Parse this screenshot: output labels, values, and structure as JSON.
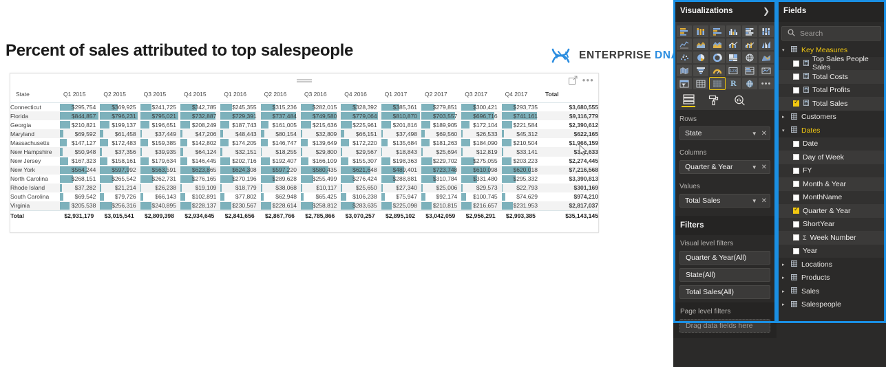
{
  "report": {
    "title": "Percent of sales attributed to top salespeople",
    "logo": {
      "primary": "ENTERPRISE",
      "secondary": "DNA",
      "icon": "dna-helix-icon"
    }
  },
  "matrix": {
    "actions": {
      "focus": "focus-mode-icon",
      "more": "more-options-icon"
    },
    "row_header": "State",
    "total_header": "Total",
    "columns": [
      "Q1 2015",
      "Q2 2015",
      "Q3 2015",
      "Q4 2015",
      "Q1 2016",
      "Q2 2016",
      "Q3 2016",
      "Q4 2016",
      "Q1 2017",
      "Q2 2017",
      "Q3 2017",
      "Q4 2017"
    ],
    "rows": [
      {
        "state": "Connecticut",
        "values": [
          "$295,754",
          "$369,925",
          "$241,725",
          "$342,785",
          "$245,355",
          "$315,236",
          "$282,015",
          "$328,392",
          "$385,361",
          "$279,851",
          "$300,421",
          "$293,735"
        ],
        "total": "$3,680,555"
      },
      {
        "state": "Florida",
        "values": [
          "$844,857",
          "$796,231",
          "$795,021",
          "$732,887",
          "$729,391",
          "$737,484",
          "$749,580",
          "$779,064",
          "$810,870",
          "$703,557",
          "$696,716",
          "$741,161"
        ],
        "total": "$9,116,779"
      },
      {
        "state": "Georgia",
        "values": [
          "$210,821",
          "$199,137",
          "$196,651",
          "$208,249",
          "$187,743",
          "$161,005",
          "$215,636",
          "$225,961",
          "$201,816",
          "$189,905",
          "$172,104",
          "$221,584"
        ],
        "total": "$2,390,612"
      },
      {
        "state": "Maryland",
        "values": [
          "$69,592",
          "$61,458",
          "$37,449",
          "$47,206",
          "$48,443",
          "$80,154",
          "$32,809",
          "$66,151",
          "$37,498",
          "$69,560",
          "$26,533",
          "$45,312"
        ],
        "total": "$622,165"
      },
      {
        "state": "Massachusetts",
        "values": [
          "$147,127",
          "$172,483",
          "$159,385",
          "$142,802",
          "$174,205",
          "$146,747",
          "$139,649",
          "$172,220",
          "$135,684",
          "$181,263",
          "$184,090",
          "$210,504"
        ],
        "total": "$1,966,159"
      },
      {
        "state": "New Hampshire",
        "values": [
          "$50,948",
          "$37,356",
          "$39,935",
          "$64,124",
          "$32,151",
          "$18,255",
          "$29,800",
          "$29,567",
          "$18,843",
          "$25,694",
          "$12,819",
          "$33,141"
        ],
        "total": "$392,633"
      },
      {
        "state": "New Jersey",
        "values": [
          "$167,323",
          "$158,161",
          "$179,634",
          "$146,445",
          "$202,716",
          "$192,407",
          "$166,109",
          "$155,307",
          "$198,363",
          "$229,702",
          "$275,055",
          "$203,223"
        ],
        "total": "$2,274,445"
      },
      {
        "state": "New York",
        "values": [
          "$564,244",
          "$597,992",
          "$563,591",
          "$623,865",
          "$624,308",
          "$597,220",
          "$580,435",
          "$621,648",
          "$489,401",
          "$723,748",
          "$610,098",
          "$620,018"
        ],
        "total": "$7,216,568"
      },
      {
        "state": "North Carolina",
        "values": [
          "$268,151",
          "$265,542",
          "$262,731",
          "$276,165",
          "$270,196",
          "$289,628",
          "$255,499",
          "$276,424",
          "$288,881",
          "$310,784",
          "$331,480",
          "$295,332"
        ],
        "total": "$3,390,813"
      },
      {
        "state": "Rhode Island",
        "values": [
          "$37,282",
          "$21,214",
          "$26,238",
          "$19,109",
          "$18,779",
          "$38,068",
          "$10,117",
          "$25,650",
          "$27,340",
          "$25,006",
          "$29,573",
          "$22,793"
        ],
        "total": "$301,169"
      },
      {
        "state": "South Carolina",
        "values": [
          "$69,542",
          "$79,726",
          "$66,143",
          "$102,891",
          "$77,802",
          "$62,948",
          "$65,425",
          "$106,238",
          "$75,947",
          "$92,174",
          "$100,745",
          "$74,629"
        ],
        "total": "$974,210"
      },
      {
        "state": "Virginia",
        "values": [
          "$205,538",
          "$256,316",
          "$240,895",
          "$228,137",
          "$230,567",
          "$228,614",
          "$258,812",
          "$283,635",
          "$225,098",
          "$210,815",
          "$216,657",
          "$231,953"
        ],
        "total": "$2,817,037"
      }
    ],
    "total_row": {
      "state": "Total",
      "values": [
        "$2,931,179",
        "$3,015,541",
        "$2,809,398",
        "$2,934,645",
        "$2,841,656",
        "$2,867,766",
        "$2,785,866",
        "$3,070,257",
        "$2,895,102",
        "$3,042,059",
        "$2,956,291",
        "$2,993,385"
      ],
      "total": "$35,143,145"
    },
    "bar_color": "#5b9eab"
  },
  "visualizations": {
    "title": "Visualizations",
    "expand_icon": "chevron-right-icon",
    "gallery": [
      "stacked-bar-chart-icon",
      "stacked-column-chart-icon",
      "clustered-bar-chart-icon",
      "clustered-column-chart-icon",
      "100-stacked-bar-chart-icon",
      "100-stacked-column-chart-icon",
      "line-chart-icon",
      "area-chart-icon",
      "stacked-area-chart-icon",
      "line-stacked-column-chart-icon",
      "line-clustered-column-chart-icon",
      "ribbon-chart-icon",
      "scatter-chart-icon",
      "pie-chart-icon",
      "donut-chart-icon",
      "treemap-icon",
      "map-icon",
      "filled-map-icon",
      "shape-map-icon",
      "funnel-chart-icon",
      "gauge-chart-icon",
      "card-icon",
      "multi-row-card-icon",
      "kpi-icon",
      "slicer-icon",
      "table-icon",
      "matrix-icon",
      "r-script-visual-icon",
      "python-visual-icon",
      "more-visuals-icon"
    ],
    "selected_visual": "matrix-icon",
    "tabs": [
      {
        "name": "fields-tab",
        "icon": "fields-well-icon",
        "active": true
      },
      {
        "name": "format-tab",
        "icon": "paint-roller-icon",
        "active": false
      },
      {
        "name": "analytics-tab",
        "icon": "magnifier-chart-icon",
        "active": false
      }
    ],
    "wells": [
      {
        "label": "Rows",
        "value": "State"
      },
      {
        "label": "Columns",
        "value": "Quarter & Year"
      },
      {
        "label": "Values",
        "value": "Total Sales"
      }
    ],
    "filters": {
      "title": "Filters",
      "visual_level_label": "Visual level filters",
      "visual_level_items": [
        "Quarter & Year(All)",
        "State(All)",
        "Total Sales(All)"
      ],
      "page_level_label": "Page level filters",
      "page_level_placeholder": "Drag data fields here"
    }
  },
  "fields": {
    "title": "Fields",
    "search_placeholder": "Search",
    "search_icon": "search-icon",
    "tree": [
      {
        "type": "table",
        "label": "Key Measures",
        "expanded": true,
        "icon": "measure-table-icon"
      },
      {
        "type": "field",
        "label": "Top Sales People Sales",
        "checked": false,
        "icon": "measure-icon"
      },
      {
        "type": "field",
        "label": "Total Costs",
        "checked": false,
        "icon": "measure-icon"
      },
      {
        "type": "field",
        "label": "Total Profits",
        "checked": false,
        "icon": "measure-icon"
      },
      {
        "type": "field",
        "label": "Total Sales",
        "checked": true,
        "icon": "measure-icon"
      },
      {
        "type": "table",
        "label": "Customers",
        "expanded": false,
        "icon": "table-icon"
      },
      {
        "type": "table",
        "label": "Dates",
        "expanded": true,
        "icon": "table-icon"
      },
      {
        "type": "field",
        "label": "Date",
        "checked": false,
        "icon": ""
      },
      {
        "type": "field",
        "label": "Day of Week",
        "checked": false,
        "icon": ""
      },
      {
        "type": "field",
        "label": "FY",
        "checked": false,
        "icon": ""
      },
      {
        "type": "field",
        "label": "Month & Year",
        "checked": false,
        "icon": ""
      },
      {
        "type": "field",
        "label": "MonthName",
        "checked": false,
        "icon": ""
      },
      {
        "type": "field",
        "label": "Quarter & Year",
        "checked": true,
        "icon": ""
      },
      {
        "type": "field",
        "label": "ShortYear",
        "checked": false,
        "icon": ""
      },
      {
        "type": "field",
        "label": "Week Number",
        "checked": false,
        "icon": "sigma-icon"
      },
      {
        "type": "field",
        "label": "Year",
        "checked": false,
        "icon": ""
      },
      {
        "type": "table",
        "label": "Locations",
        "expanded": false,
        "icon": "table-icon"
      },
      {
        "type": "table",
        "label": "Products",
        "expanded": false,
        "icon": "table-icon"
      },
      {
        "type": "table",
        "label": "Sales",
        "expanded": false,
        "icon": "table-icon"
      },
      {
        "type": "table",
        "label": "Salespeople",
        "expanded": false,
        "icon": "table-icon"
      }
    ]
  },
  "theme": {
    "accent_blue": "#1a8fe3",
    "highlight_yellow": "#f2c811",
    "panel_bg": "#2b2a29",
    "bar_teal": "#5b9eab"
  }
}
